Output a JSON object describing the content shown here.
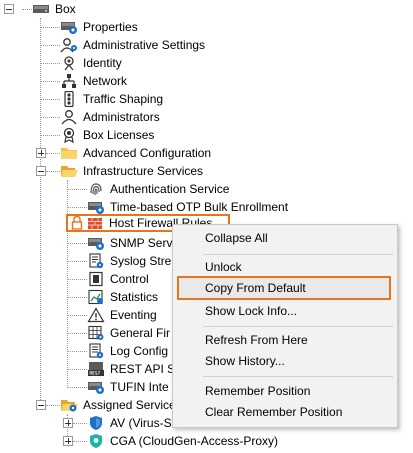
{
  "tree": {
    "root": "Box",
    "items": [
      "Properties",
      "Administrative Settings",
      "Identity",
      "Network",
      "Traffic Shaping",
      "Administrators",
      "Box Licenses",
      "Advanced Configuration",
      "Infrastructure Services",
      "Authentication Service",
      "Time-based OTP Bulk Enrollment",
      "Host Firewall Rules",
      "SNMP Serv",
      "Syslog Stre",
      "Control",
      "Statistics",
      "Eventing",
      "General Fir",
      "Log Config",
      "REST API S",
      "TUFIN Inte",
      "Assigned Service",
      "AV (Virus-S",
      "CGA (CloudGen-Access-Proxy)"
    ]
  },
  "context_menu": {
    "items": [
      "Collapse All",
      "Unlock",
      "Copy From Default",
      "Show Lock Info...",
      "Refresh From Here",
      "Show History...",
      "Remember Position",
      "Clear Remember Position"
    ]
  },
  "colors": {
    "highlight": "#e8741c",
    "folder": "#f5c342",
    "accent_blue": "#1f6fc5"
  }
}
